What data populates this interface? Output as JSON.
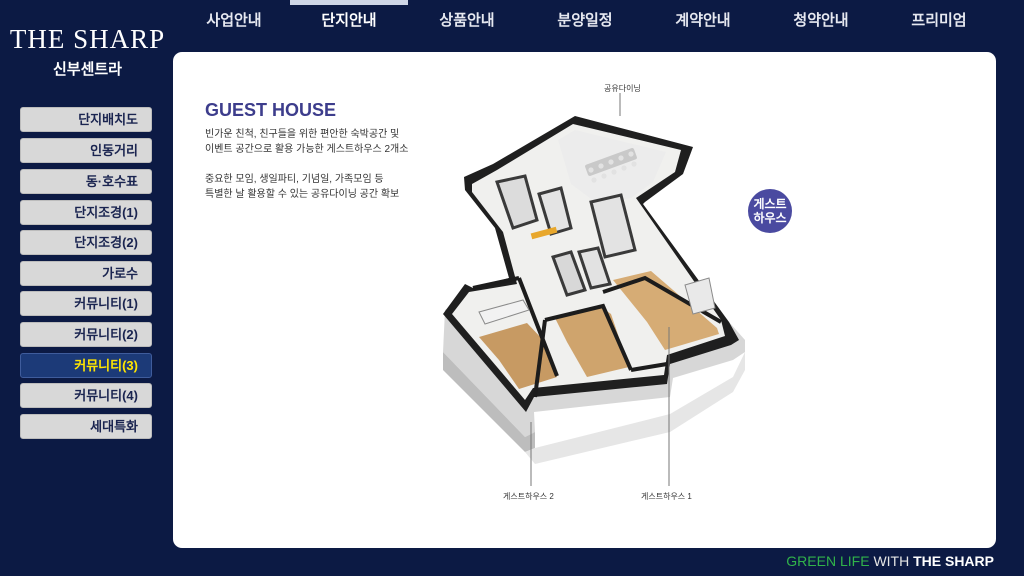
{
  "logo": {
    "brand": "THE SHARP",
    "subtitle": "신부센트라"
  },
  "topnav": {
    "items": [
      "사업안내",
      "단지안내",
      "상품안내",
      "분양일정",
      "계약안내",
      "청약안내",
      "프리미엄"
    ],
    "active_index": 1
  },
  "sidebar": {
    "items": [
      "단지배치도",
      "인동거리",
      "동·호수표",
      "단지조경(1)",
      "단지조경(2)",
      "가로수",
      "커뮤니티(1)",
      "커뮤니티(2)",
      "커뮤니티(3)",
      "커뮤니티(4)",
      "세대특화"
    ],
    "active_index": 8
  },
  "content": {
    "title": "GUEST HOUSE",
    "desc_line1": "빈가운 친척, 친구들을 위한 편안한 숙박공간 및",
    "desc_line2": "이벤트 공간으로 활용 가능한 게스트하우스 2개소",
    "desc_line3": "중요한 모임, 생일파티, 기념일, 가족모임 등",
    "desc_line4": "특별한 날 활용할 수 있는 공유다이닝 공간 확보",
    "badge_line1": "게스트",
    "badge_line2": "하우스",
    "label_dining": "공유다이닝",
    "label_gh2": "게스트하우스 2",
    "label_gh1": "게스트하우스 1"
  },
  "footer": {
    "green": "GREEN LIFE",
    "with": "WITH",
    "brand": "THE SHARP"
  },
  "colors": {
    "background": "#0c1a44",
    "active_sidebar": "#1c3a78",
    "active_text": "#ffe600",
    "title": "#3d3d8c",
    "badge": "#4a4aa0",
    "footer_green": "#31b34a"
  }
}
